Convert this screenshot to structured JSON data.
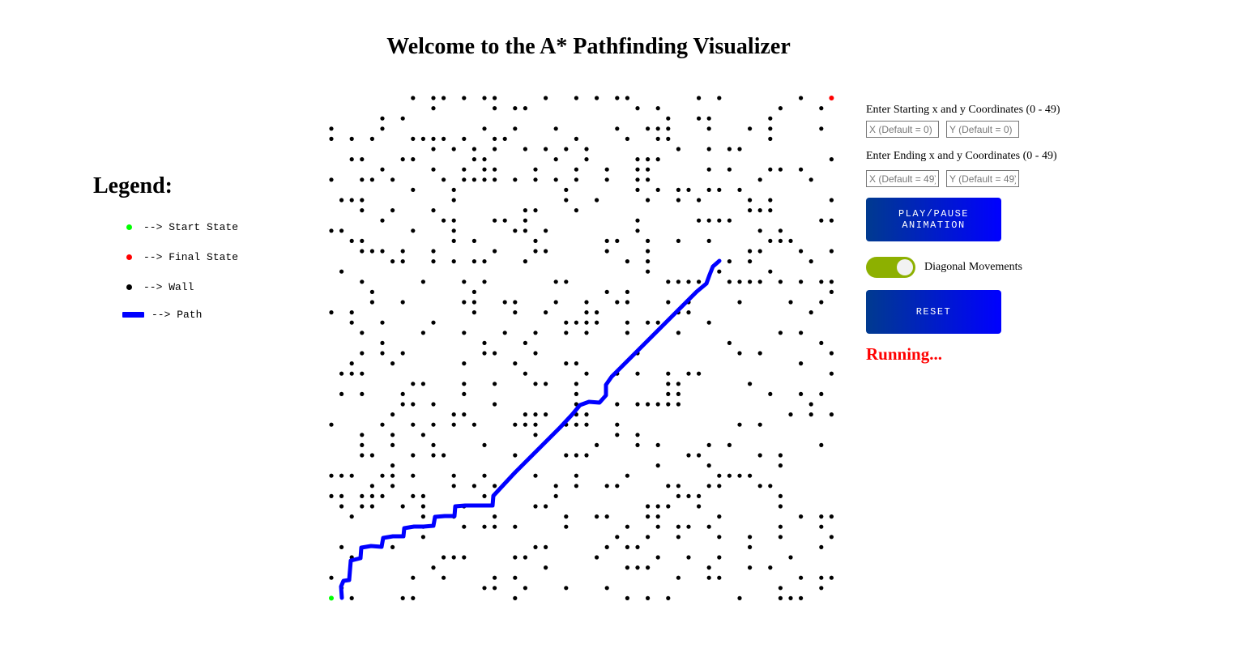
{
  "page": {
    "title": "Welcome to the A* Pathfinding Visualizer"
  },
  "legend": {
    "title": "Legend:",
    "items": [
      {
        "label": "--> Start State",
        "color": "#00ff00",
        "icon": "start-dot-icon"
      },
      {
        "label": "--> Final State",
        "color": "#ff0000",
        "icon": "final-dot-icon"
      },
      {
        "label": "--> Wall",
        "color": "#000000",
        "icon": "wall-dot-icon"
      },
      {
        "label": "--> Path",
        "color": "#0000ff",
        "icon": "path-line-icon"
      }
    ]
  },
  "controls": {
    "start_label": "Enter Starting x and y Coordinates (0 - 49)",
    "start_x_placeholder": "X (Default = 0)",
    "start_y_placeholder": "Y (Default = 0)",
    "end_label": "Enter Ending x and y Coordinates (0 - 49)",
    "end_x_placeholder": "X (Default = 49)",
    "end_y_placeholder": "Y (Default = 49)",
    "play_pause_label": "PLAY/PAUSE ANIMATION",
    "diagonal_label": "Diagonal Movements",
    "diagonal_enabled": true,
    "reset_label": "RESET",
    "status": "Running...",
    "status_color": "#ff0000",
    "toggle_color": "#8db000"
  }
}
